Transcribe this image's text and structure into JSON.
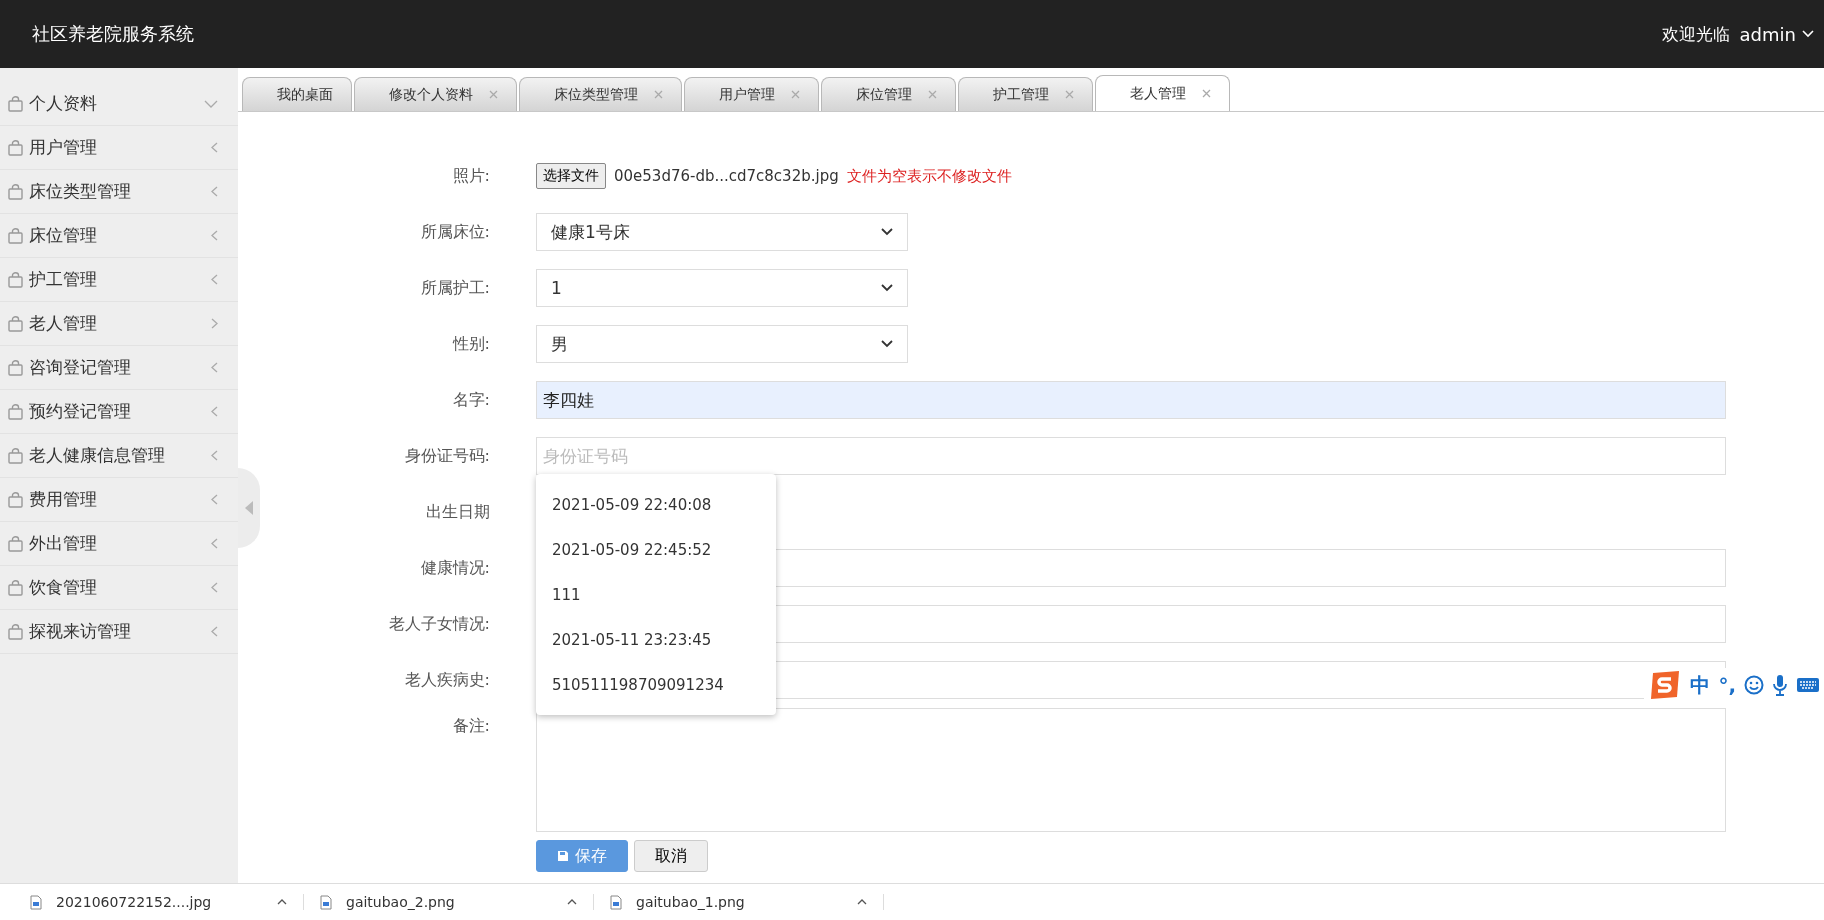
{
  "header": {
    "title": "社区养老院服务系统",
    "welcome": "欢迎光临",
    "user": "admin"
  },
  "sidebar": {
    "items": [
      {
        "label": "个人资料",
        "kind": "open"
      },
      {
        "label": "用户管理",
        "kind": "closed"
      },
      {
        "label": "床位类型管理",
        "kind": "closed"
      },
      {
        "label": "床位管理",
        "kind": "closed"
      },
      {
        "label": "护工管理",
        "kind": "closed"
      },
      {
        "label": "老人管理",
        "kind": "active"
      },
      {
        "label": "咨询登记管理",
        "kind": "closed"
      },
      {
        "label": "预约登记管理",
        "kind": "closed"
      },
      {
        "label": "老人健康信息管理",
        "kind": "closed"
      },
      {
        "label": "费用管理",
        "kind": "closed"
      },
      {
        "label": "外出管理",
        "kind": "closed"
      },
      {
        "label": "饮食管理",
        "kind": "closed"
      },
      {
        "label": "探视来访管理",
        "kind": "closed"
      }
    ]
  },
  "tabs": [
    {
      "label": "我的桌面",
      "selected": false,
      "closable": false
    },
    {
      "label": "修改个人资料",
      "selected": false,
      "closable": true
    },
    {
      "label": "床位类型管理",
      "selected": false,
      "closable": true
    },
    {
      "label": "用户管理",
      "selected": false,
      "closable": true
    },
    {
      "label": "床位管理",
      "selected": false,
      "closable": true
    },
    {
      "label": "护工管理",
      "selected": false,
      "closable": true
    },
    {
      "label": "老人管理",
      "selected": true,
      "closable": true
    }
  ],
  "form": {
    "fields": [
      {
        "kind": "file",
        "label": "照片:",
        "button": "选择文件",
        "filename": "00e53d76-db...cd7c8c32b.jpg",
        "note": "文件为空表示不修改文件"
      },
      {
        "kind": "select",
        "label": "所属床位:",
        "value": "健康1号床"
      },
      {
        "kind": "select",
        "label": "所属护工:",
        "value": "1"
      },
      {
        "kind": "select",
        "label": "性别:",
        "value": "男"
      },
      {
        "kind": "text",
        "label": "名字:",
        "value": "李四娃",
        "autofilled": true
      },
      {
        "kind": "text",
        "label": "身份证号码:",
        "placeholder": "身份证号码",
        "autofilled": false
      },
      {
        "kind": "date",
        "label": "出生日期"
      },
      {
        "kind": "text",
        "label": "健康情况:",
        "autofilled": false
      },
      {
        "kind": "text",
        "label": "老人子女情况:",
        "autofilled": false
      },
      {
        "kind": "text",
        "label": "老人疾病史:",
        "autofilled": false
      },
      {
        "kind": "textarea",
        "label": "备注:"
      }
    ],
    "autocomplete": [
      "2021-05-09 22:40:08",
      "2021-05-09 22:45:52",
      "111",
      "2021-05-11 23:23:45",
      "510511198709091234"
    ],
    "buttons": [
      {
        "label": "保存",
        "kind": "primary"
      },
      {
        "label": "取消",
        "kind": "default"
      }
    ]
  },
  "ime_toolbar": {
    "labels": [
      "中",
      "°,"
    ]
  },
  "downloads": [
    "2021060722152....jpg",
    "gaitubao_2.png",
    "gaitubao_1.png"
  ]
}
